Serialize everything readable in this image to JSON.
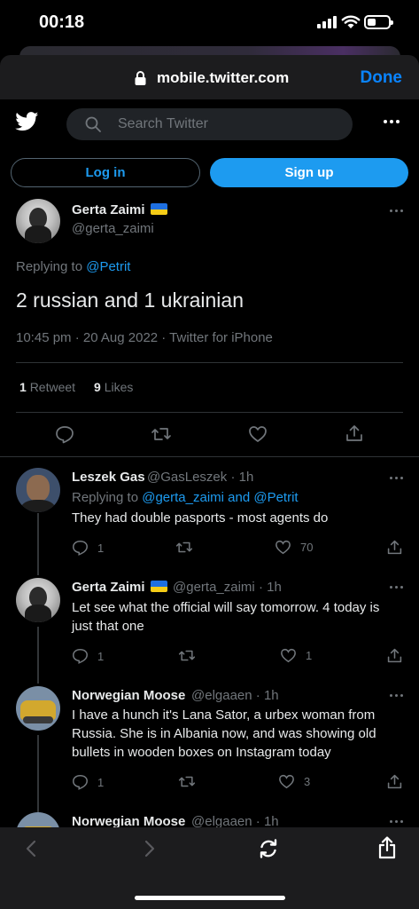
{
  "status_bar": {
    "time": "00:18"
  },
  "browser": {
    "url": "mobile.twitter.com",
    "done_label": "Done"
  },
  "twitter": {
    "search_placeholder": "Search Twitter",
    "login_label": "Log in",
    "signup_label": "Sign up"
  },
  "main_tweet": {
    "author_name": "Gerta Zaimi",
    "author_handle": "@gerta_zaimi",
    "replying_prefix": "Replying to",
    "replying_to": "@Petrit",
    "text": "2 russian and 1 ukrainian",
    "meta": "10:45 pm · 20 Aug 2022 · Twitter for iPhone",
    "retweets_count": "1",
    "retweets_label": "Retweet",
    "likes_count": "9",
    "likes_label": "Likes"
  },
  "replies": [
    {
      "name": "Leszek Gas",
      "handle": "@GasLeszek",
      "time": "· 1h",
      "replying_prefix": "Replying to",
      "replying_to": "@gerta_zaimi and @Petrit",
      "text": "They had double pasports - most agents do",
      "reply_count": "1",
      "retweet_count": "",
      "like_count": "70"
    },
    {
      "name": "Gerta Zaimi",
      "handle": "@gerta_zaimi",
      "time": "· 1h",
      "text_line1": "Let see what the official will say tomorrow. 4 today is",
      "text_line2": "just that one",
      "reply_count": "1",
      "retweet_count": "",
      "like_count": "1"
    },
    {
      "name": "Norwegian Moose",
      "handle": "@elgaaen",
      "time": "· 1h",
      "text_line1": "I have a hunch it's Lana Sator, a urbex woman from",
      "text_line2": "Russia.  She is in Albania now, and was showing old",
      "text_line3": "bullets in wooden boxes on Instagram today",
      "reply_count": "1",
      "retweet_count": "",
      "like_count": "3"
    },
    {
      "name": "Norwegian Moose",
      "handle": "@elgaaen",
      "time": "· 1h"
    }
  ],
  "colors": {
    "accent": "#1d9bf0",
    "ios_blue": "#0a84ff",
    "background": "#000000"
  }
}
